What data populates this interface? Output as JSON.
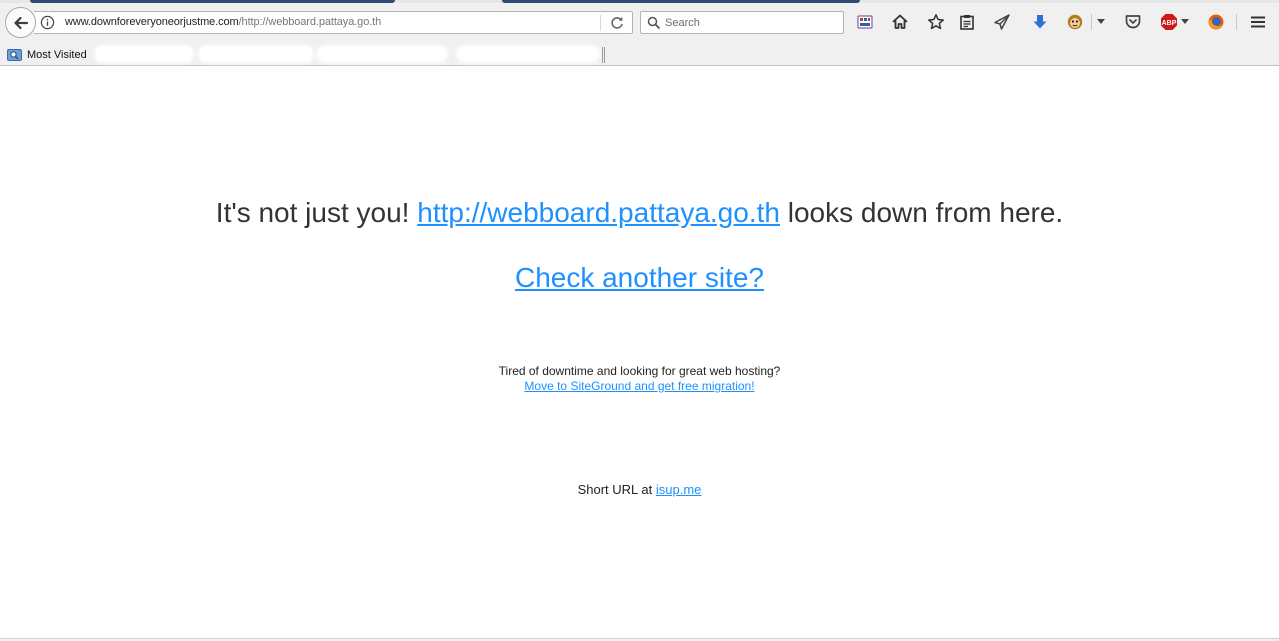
{
  "browser": {
    "url": {
      "domain": "www.downforeveryoneorjustme.com",
      "path": "/http://webboard.pattaya.go.th"
    },
    "search": {
      "placeholder": "Search"
    },
    "bookmarks": {
      "most_visited_label": "Most Visited"
    },
    "icons": {
      "back": "back-arrow-icon",
      "info": "info-icon",
      "reload": "reload-icon",
      "search": "search-icon",
      "extension": "extension-icon",
      "home": "home-icon",
      "bookmark_star": "star-icon",
      "reading_list": "clipboard-icon",
      "send": "paper-plane-icon",
      "download": "download-arrow-icon",
      "monkey": "greasemonkey-icon",
      "pocket": "pocket-icon",
      "adblock": "adblock-plus-icon",
      "firefox": "firefox-icon",
      "menu": "hamburger-menu-icon"
    },
    "adblock_badge": "ABP"
  },
  "page": {
    "headline_prefix": "It's not just you!",
    "headline_link": "http://webboard.pattaya.go.th",
    "headline_suffix": "looks down from here.",
    "check_link": "Check another site?",
    "ad_text": "Tired of downtime and looking for great web hosting?",
    "ad_link": "Move to SiteGround and get free migration!",
    "short_prefix": "Short URL at",
    "short_link": "isup.me"
  },
  "colors": {
    "link": "#1e90ff",
    "text": "#333333",
    "chrome": "#f0f0f0"
  }
}
